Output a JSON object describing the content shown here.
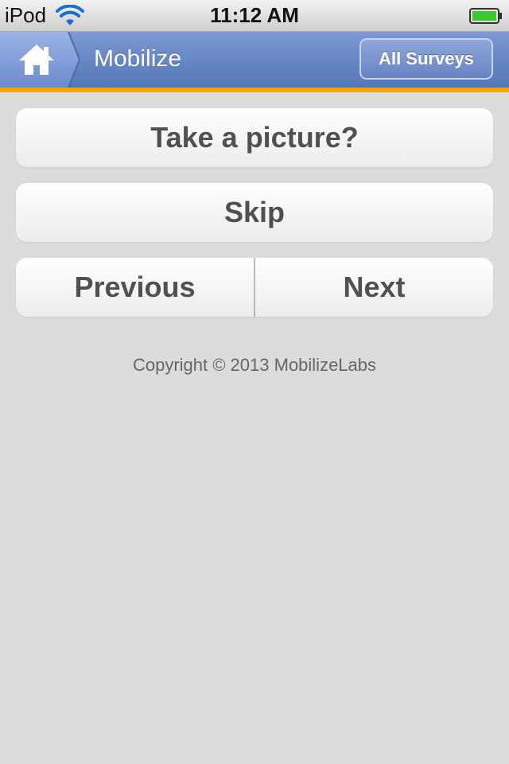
{
  "status_bar": {
    "carrier": "iPod",
    "time": "11:12 AM",
    "wifi_icon": "wifi-icon",
    "battery_icon": "battery-icon"
  },
  "header": {
    "home_icon": "home-icon",
    "title": "Mobilize",
    "all_surveys_label": "All Surveys",
    "accent_color": "#f3a800",
    "bar_color": "#6584c4"
  },
  "main": {
    "take_picture_label": "Take a picture?",
    "skip_label": "Skip",
    "previous_label": "Previous",
    "next_label": "Next"
  },
  "footer": {
    "copyright": "Copyright © 2013 MobilizeLabs"
  }
}
